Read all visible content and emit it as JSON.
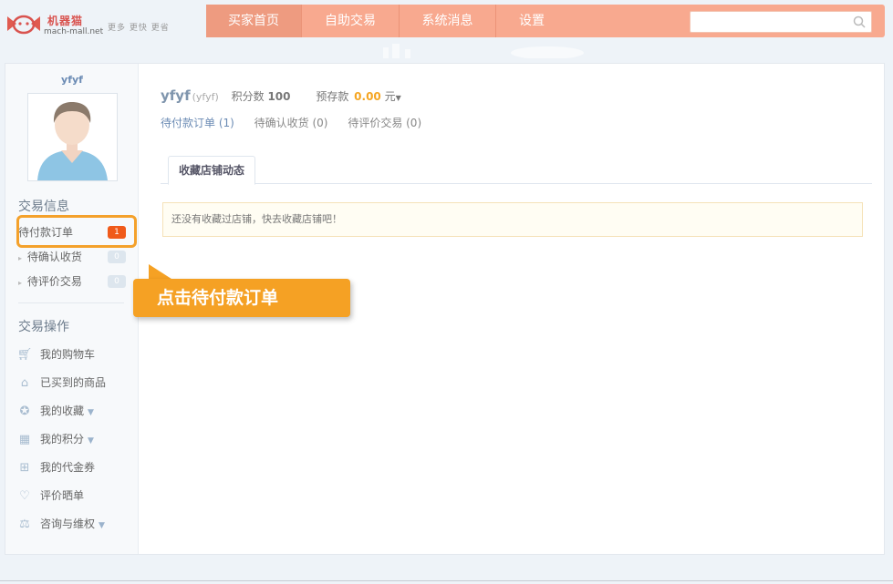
{
  "brand": {
    "name": "机器猫",
    "url": "mach-mall.net",
    "slogan": "更多 更快 更省"
  },
  "nav": {
    "items": [
      "买家首页",
      "自助交易",
      "系统消息",
      "设置"
    ],
    "active": "买家首页"
  },
  "search": {
    "placeholder": ""
  },
  "sidebar": {
    "username": "yfyf",
    "trade_info_title": "交易信息",
    "trade_items": [
      {
        "label": "待付款订单",
        "count": "1"
      },
      {
        "label": "待确认收货",
        "count": "0"
      },
      {
        "label": "待评价交易",
        "count": "0"
      }
    ],
    "trade_ops_title": "交易操作",
    "ops": [
      {
        "label": "我的购物车",
        "icon": "cart-icon"
      },
      {
        "label": "已买到的商品",
        "icon": "basket-icon"
      },
      {
        "label": "我的收藏",
        "icon": "medal-icon",
        "dropdown": true
      },
      {
        "label": "我的积分",
        "icon": "calculator-icon",
        "dropdown": true
      },
      {
        "label": "我的代金券",
        "icon": "gift-icon"
      },
      {
        "label": "评价晒单",
        "icon": "heart-icon"
      },
      {
        "label": "咨询与维权",
        "icon": "scale-icon",
        "dropdown": true
      }
    ]
  },
  "user": {
    "name": "yfyf",
    "sub_name": "(yfyf)",
    "points_label": "积分数",
    "points": "100",
    "balance_label": "预存款",
    "balance": "0.00",
    "currency": "元"
  },
  "status": [
    "待付款订单 (1)",
    "待确认收货 (0)",
    "待评价交易 (0)"
  ],
  "tab": {
    "label": "收藏店铺动态"
  },
  "notice": "还没有收藏过店铺，快去收藏店铺吧！",
  "callout": "点击待付款订单",
  "colors": {
    "nav_bg": "#f8a98f",
    "callout": "#f5a124",
    "badge_hot": "#f05a1a",
    "link": "#6b8bb4"
  }
}
